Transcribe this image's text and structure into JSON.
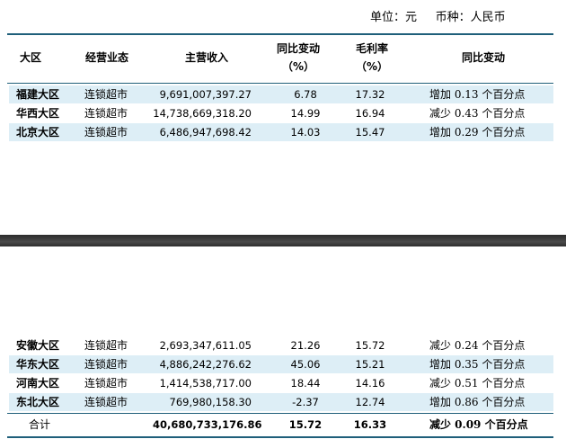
{
  "unit_line": "单位：元     币种：人民币",
  "headers": {
    "region": "大区",
    "business_type": "经营业态",
    "revenue": "主营收入",
    "yoy_line1": "同比变动",
    "yoy_line2": "（%）",
    "gross_margin_line1": "毛利率",
    "gross_margin_line2": "（%）",
    "margin_change": "同比变动"
  },
  "rows": [
    {
      "region": "福建大区",
      "business_type": "连锁超市",
      "revenue": "9,691,007,397.27",
      "yoy": "6.78",
      "gross_margin": "17.32",
      "margin_change": "增加 0.13 个百分点"
    },
    {
      "region": "华西大区",
      "business_type": "连锁超市",
      "revenue": "14,738,669,318.20",
      "yoy": "14.99",
      "gross_margin": "16.94",
      "margin_change": "减少 0.43 个百分点"
    },
    {
      "region": "北京大区",
      "business_type": "连锁超市",
      "revenue": "6,486,947,698.42",
      "yoy": "14.03",
      "gross_margin": "15.47",
      "margin_change": "增加 0.29 个百分点"
    },
    {
      "region": "安徽大区",
      "business_type": "连锁超市",
      "revenue": "2,693,347,611.05",
      "yoy": "21.26",
      "gross_margin": "15.72",
      "margin_change": "减少 0.24 个百分点"
    },
    {
      "region": "华东大区",
      "business_type": "连锁超市",
      "revenue": "4,886,242,276.62",
      "yoy": "45.06",
      "gross_margin": "15.21",
      "margin_change": "增加 0.35 个百分点"
    },
    {
      "region": "河南大区",
      "business_type": "连锁超市",
      "revenue": "1,414,538,717.00",
      "yoy": "18.44",
      "gross_margin": "14.16",
      "margin_change": "减少 0.51 个百分点"
    },
    {
      "region": "东北大区",
      "business_type": "连锁超市",
      "revenue": "769,980,158.30",
      "yoy": "-2.37",
      "gross_margin": "12.74",
      "margin_change": "增加 0.86 个百分点"
    }
  ],
  "total": {
    "label": "合计",
    "revenue": "40,680,733,176.86",
    "yoy": "15.72",
    "gross_margin": "16.33",
    "margin_change": "减少 0.09 个百分点"
  }
}
